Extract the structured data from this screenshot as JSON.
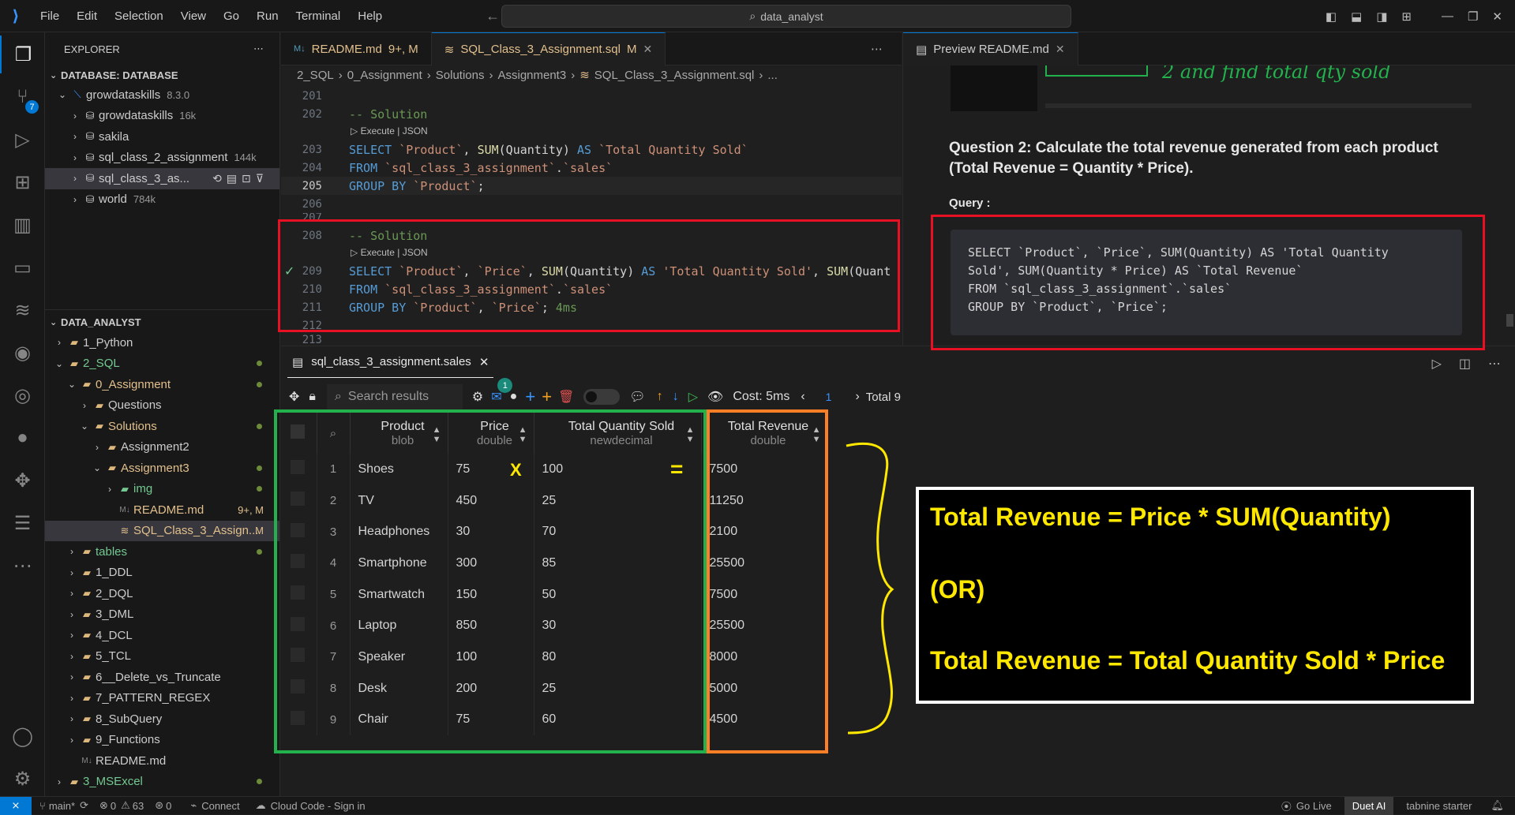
{
  "titlebar": {
    "menu": [
      "File",
      "Edit",
      "Selection",
      "View",
      "Go",
      "Run",
      "Terminal",
      "Help"
    ],
    "search": "data_analyst"
  },
  "explorer": {
    "title": "EXPLORER",
    "db_section": "DATABASE: DATABASE",
    "db_root": {
      "name": "growdataskills",
      "version": "8.3.0"
    },
    "db_items": [
      {
        "name": "growdataskills",
        "size": "16k"
      },
      {
        "name": "sakila",
        "size": ""
      },
      {
        "name": "sql_class_2_assignment",
        "size": "144k"
      },
      {
        "name": "sql_class_3_as...",
        "size": ""
      },
      {
        "name": "world",
        "size": "784k"
      }
    ],
    "folder_section": "DATA_ANALYST",
    "files": [
      {
        "name": "1_Python",
        "depth": 1,
        "type": "folder",
        "open": false
      },
      {
        "name": "2_SQL",
        "depth": 1,
        "type": "folder",
        "open": true
      },
      {
        "name": "0_Assignment",
        "depth": 2,
        "type": "folder",
        "open": true
      },
      {
        "name": "Questions",
        "depth": 3,
        "type": "folder",
        "open": false
      },
      {
        "name": "Solutions",
        "depth": 3,
        "type": "folder",
        "open": true
      },
      {
        "name": "Assignment2",
        "depth": 4,
        "type": "folder",
        "open": false
      },
      {
        "name": "Assignment3",
        "depth": 4,
        "type": "folder",
        "open": true
      },
      {
        "name": "img",
        "depth": 5,
        "type": "img",
        "open": false
      },
      {
        "name": "README.md",
        "depth": 5,
        "type": "md",
        "badge": "9+, M"
      },
      {
        "name": "SQL_Class_3_Assign...",
        "depth": 5,
        "type": "sql",
        "badge": "M"
      },
      {
        "name": "tables",
        "depth": 2,
        "type": "folder",
        "open": false
      },
      {
        "name": "1_DDL",
        "depth": 2,
        "type": "folder",
        "open": false
      },
      {
        "name": "2_DQL",
        "depth": 2,
        "type": "folder",
        "open": false
      },
      {
        "name": "3_DML",
        "depth": 2,
        "type": "folder",
        "open": false
      },
      {
        "name": "4_DCL",
        "depth": 2,
        "type": "folder",
        "open": false
      },
      {
        "name": "5_TCL",
        "depth": 2,
        "type": "folder",
        "open": false
      },
      {
        "name": "6__Delete_vs_Truncate",
        "depth": 2,
        "type": "folder",
        "open": false
      },
      {
        "name": "7_PATTERN_REGEX",
        "depth": 2,
        "type": "folder",
        "open": false
      },
      {
        "name": "8_SubQuery",
        "depth": 2,
        "type": "folder",
        "open": false
      },
      {
        "name": "9_Functions",
        "depth": 2,
        "type": "folder",
        "open": false
      },
      {
        "name": "README.md",
        "depth": 2,
        "type": "md"
      },
      {
        "name": "3_MSExcel",
        "depth": 1,
        "type": "folder",
        "open": false
      },
      {
        "name": ".gitignore",
        "depth": 1,
        "type": "git"
      },
      {
        "name": "LICENSE",
        "depth": 1,
        "type": "lic"
      }
    ]
  },
  "editor": {
    "tabs": [
      {
        "label": "README.md",
        "badge": "9+, M"
      },
      {
        "label": "SQL_Class_3_Assignment.sql",
        "badge": "M"
      }
    ],
    "breadcrumb": [
      "2_SQL",
      "0_Assignment",
      "Solutions",
      "Assignment3",
      "SQL_Class_3_Assignment.sql",
      "..."
    ],
    "lens": "Execute | JSON",
    "timing": "4ms"
  },
  "preview": {
    "tab": "Preview README.md",
    "handwriting": "2 and find total qty sold",
    "question": "Question 2: Calculate the total revenue generated from each product (Total Revenue = Quantity * Price).",
    "query_label": "Query :",
    "query_lines": [
      "SELECT `Product`, `Price`, SUM(Quantity) AS 'Total Quantity",
      "Sold', SUM(Quantity * Price) AS `Total Revenue`",
      "FROM `sql_class_3_assignment`.`sales`",
      "GROUP BY `Product`, `Price`;"
    ]
  },
  "results": {
    "tab": "sql_class_3_assignment.sales",
    "search_placeholder": "Search results",
    "cost": "Cost: 5ms",
    "page": "1",
    "total": "Total 9",
    "notif": "1",
    "columns": [
      {
        "name": "Product",
        "type": "blob"
      },
      {
        "name": "Price",
        "type": "double"
      },
      {
        "name": "Total Quantity Sold",
        "type": "newdecimal"
      },
      {
        "name": "Total Revenue",
        "type": "double"
      }
    ],
    "rows": [
      [
        "1",
        "Shoes",
        "75",
        "100",
        "7500"
      ],
      [
        "2",
        "TV",
        "450",
        "25",
        "11250"
      ],
      [
        "3",
        "Headphones",
        "30",
        "70",
        "2100"
      ],
      [
        "4",
        "Smartphone",
        "300",
        "85",
        "25500"
      ],
      [
        "5",
        "Smartwatch",
        "150",
        "50",
        "7500"
      ],
      [
        "6",
        "Laptop",
        "850",
        "30",
        "25500"
      ],
      [
        "7",
        "Speaker",
        "100",
        "80",
        "8000"
      ],
      [
        "8",
        "Desk",
        "200",
        "25",
        "5000"
      ],
      [
        "9",
        "Chair",
        "75",
        "60",
        "4500"
      ]
    ],
    "multiply_mark": "X",
    "equals_mark": "="
  },
  "annotation": {
    "line1": "Total Revenue = Price * SUM(Quantity)",
    "line2": "(OR)",
    "line3": "Total Revenue = Total Quantity Sold * Price"
  },
  "statusbar": {
    "branch": "main*",
    "problems": "0",
    "warnings": "63",
    "ports": "0",
    "connect": "Connect",
    "cloud": "Cloud Code - Sign in",
    "golive": "Go Live",
    "duet": "Duet AI",
    "tabnine": "tabnine starter"
  },
  "colors": {
    "accent": "#0078d4",
    "annotation_red": "#e81123",
    "annotation_green": "#22b14c",
    "annotation_orange": "#ff7f27",
    "annotation_yellow": "#ffe800"
  }
}
